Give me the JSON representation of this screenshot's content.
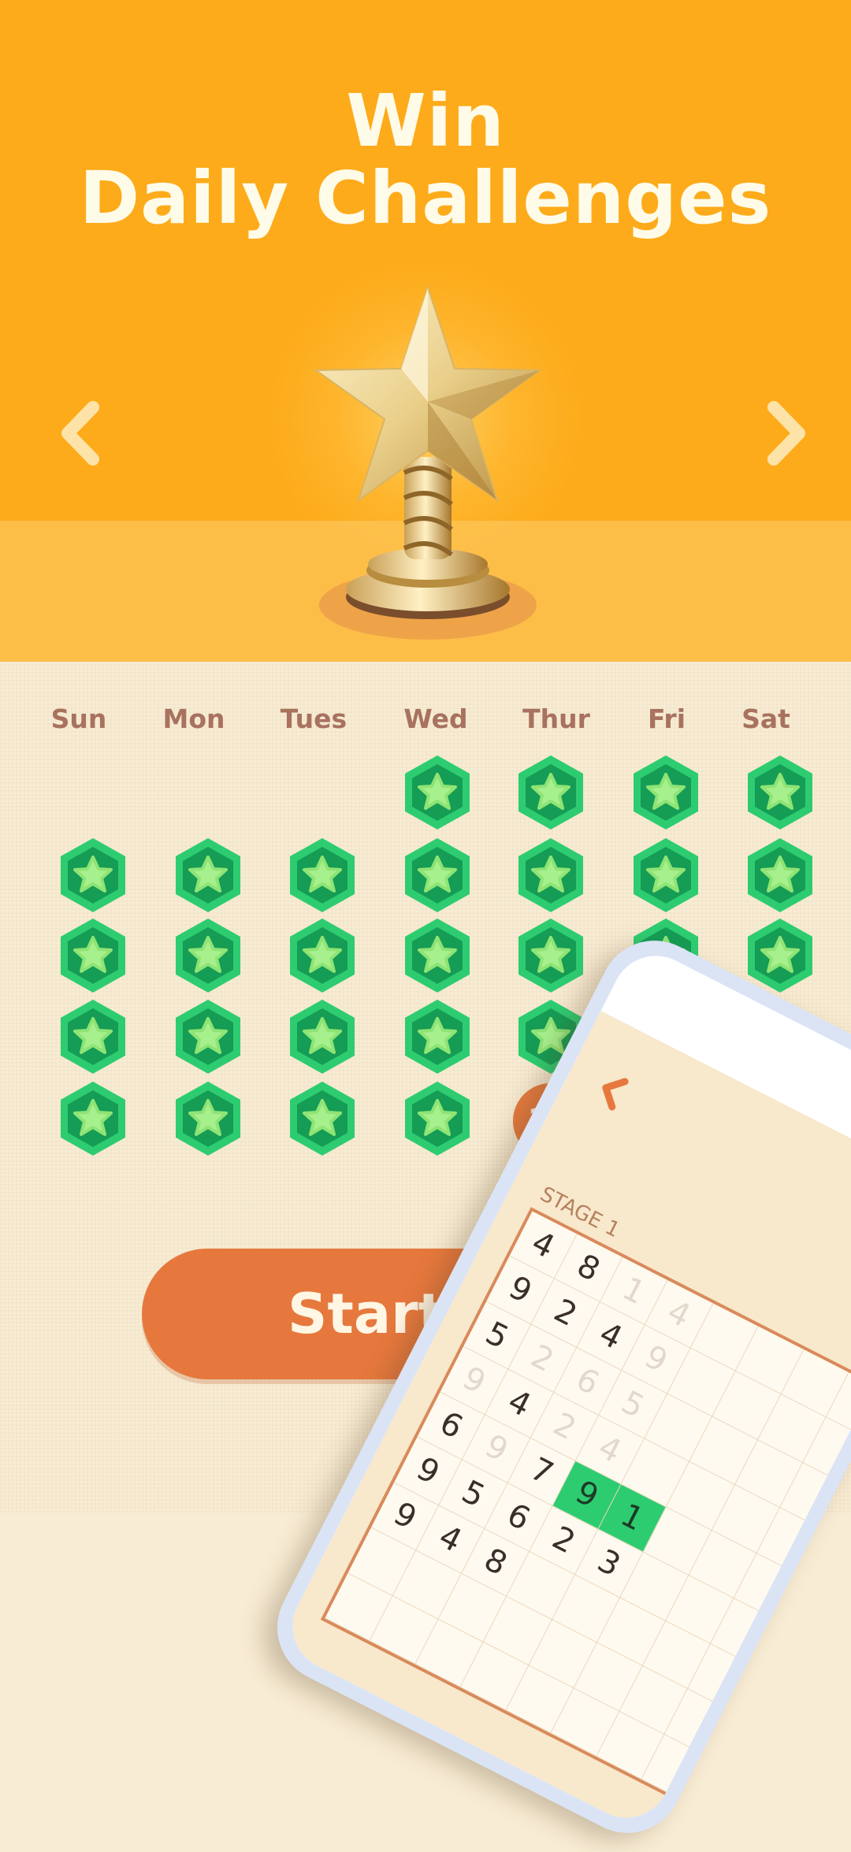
{
  "header": {
    "title_line1": "Win",
    "title_line2": "Daily Challenges"
  },
  "carousel": {
    "prev_icon": "chevron-left-icon",
    "next_icon": "chevron-right-icon"
  },
  "calendar": {
    "weekdays": [
      "Sun",
      "Mon",
      "Tues",
      "Wed",
      "Thur",
      "Fri",
      "Sat"
    ],
    "today": "30",
    "completed_icon": "star-hexagon-icon"
  },
  "actions": {
    "start_label": "Start Game"
  },
  "phone_preview": {
    "stage_label": "STAGE 1",
    "back_icon": "chevron-left-icon",
    "rows": [
      [
        "4",
        "8",
        "1",
        "4"
      ],
      [
        "9",
        "2",
        "4",
        "9"
      ],
      [
        "5",
        "2",
        "6",
        "5"
      ],
      [
        "9",
        "4",
        "2",
        "4"
      ],
      [
        "6",
        "9",
        "7",
        "9",
        "1"
      ],
      [
        "9",
        "5",
        "6",
        "2",
        "3"
      ],
      [
        "9",
        "4",
        "8"
      ]
    ]
  },
  "colors": {
    "hero_bg": "#fdab1a",
    "accent": "#e6783d",
    "star_green": "#2ecc71",
    "weekday_text": "#a8725f"
  }
}
